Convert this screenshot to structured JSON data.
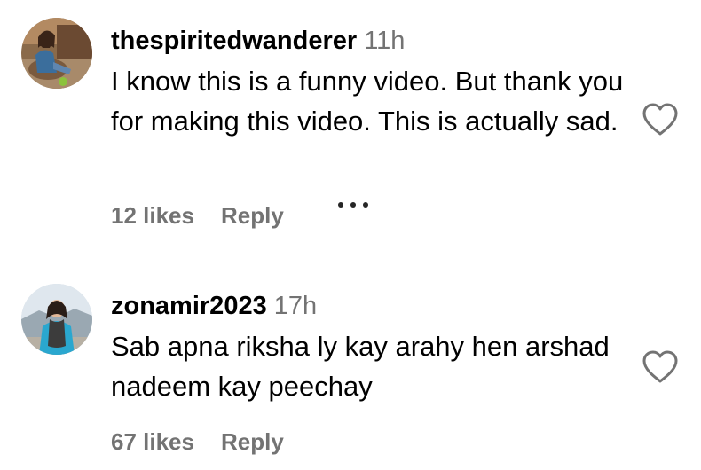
{
  "comments": [
    {
      "username": "thespiritedwanderer",
      "time": "11h",
      "text": "I know this is a funny video. But thank you for making this video. This is actually sad.",
      "likes": "12 likes",
      "reply": "Reply",
      "has_more_menu": true,
      "avatar_icon": "user-avatar-photo",
      "like_icon": "heart-outline-icon"
    },
    {
      "username": "zonamir2023",
      "time": "17h",
      "text": "Sab apna riksha ly kay arahy hen arshad nadeem kay peechay",
      "likes": "67 likes",
      "reply": "Reply",
      "has_more_menu": false,
      "avatar_icon": "user-avatar-photo",
      "like_icon": "heart-outline-icon"
    }
  ],
  "colors": {
    "text": "#000000",
    "secondary": "#737373",
    "background": "#ffffff"
  }
}
